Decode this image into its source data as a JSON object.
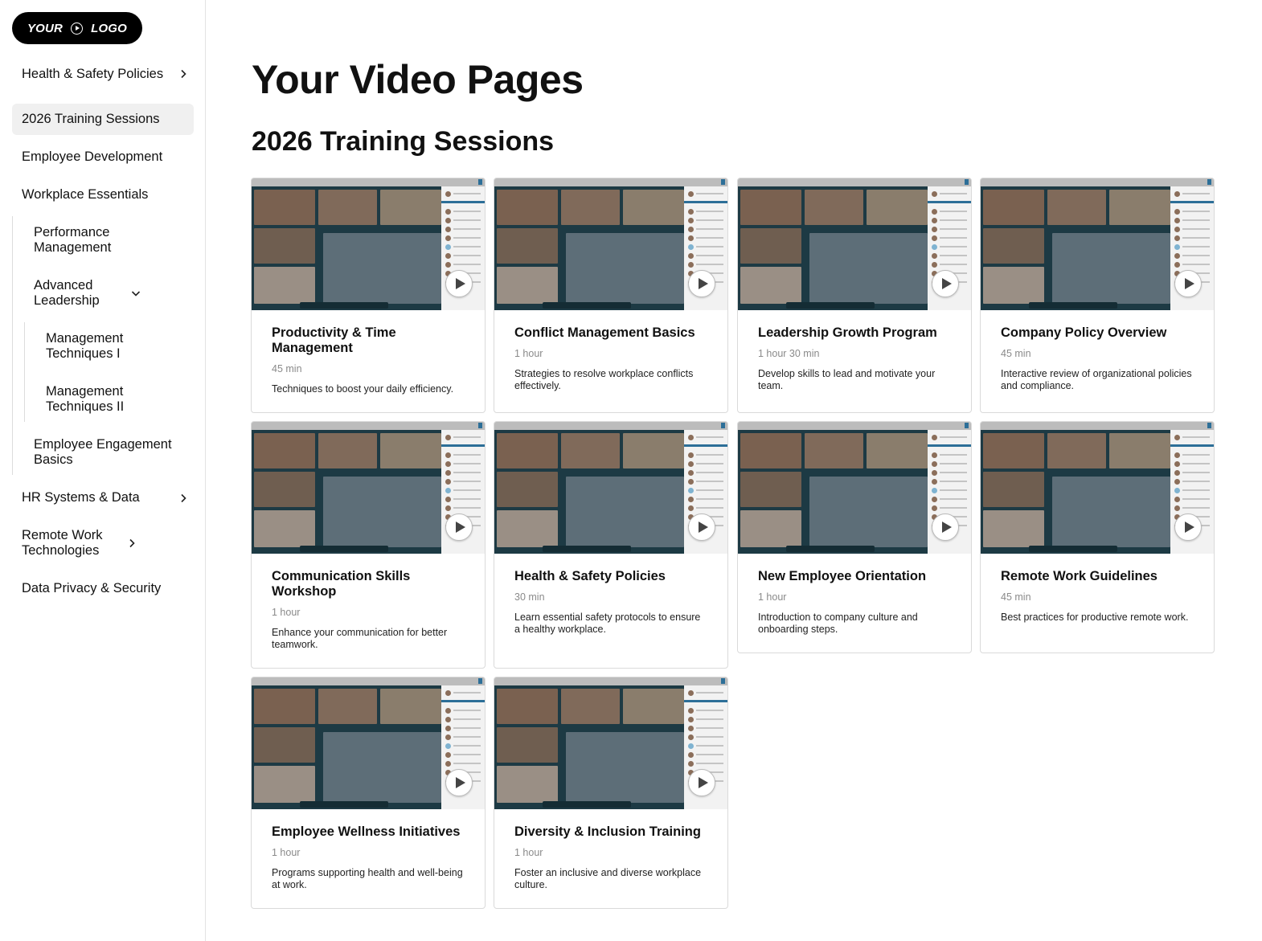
{
  "logo": {
    "left": "YOUR",
    "right": "LOGO"
  },
  "sidebar": {
    "items": [
      {
        "label": "Health & Safety Policies",
        "chevron": "right"
      },
      {
        "label": "2026 Training Sessions",
        "active": true
      },
      {
        "label": "Employee Development"
      },
      {
        "label": "Workplace Essentials"
      },
      {
        "label": "Performance Management"
      },
      {
        "label": "Advanced Leadership",
        "chevron": "down"
      },
      {
        "label": "Management Techniques I"
      },
      {
        "label": "Management Techniques II"
      },
      {
        "label": "Employee Engagement Basics"
      },
      {
        "label": "HR Systems & Data",
        "chevron": "right"
      },
      {
        "label": "Remote Work Technologies",
        "chevron": "right"
      },
      {
        "label": "Data Privacy & Security"
      }
    ]
  },
  "main": {
    "page_title": "Your Video Pages",
    "section_title": "2026 Training Sessions",
    "cards": [
      {
        "title": "Productivity & Time Management",
        "duration": "45 min",
        "description": "Techniques to boost your daily efficiency."
      },
      {
        "title": "Conflict Management Basics",
        "duration": "1 hour",
        "description": "Strategies to resolve workplace conflicts effectively."
      },
      {
        "title": "Leadership Growth Program",
        "duration": "1 hour 30 min",
        "description": "Develop skills to lead and motivate your team."
      },
      {
        "title": "Company Policy Overview",
        "duration": "45 min",
        "description": "Interactive review of organizational policies and compliance."
      },
      {
        "title": "Communication Skills Workshop",
        "duration": "1 hour",
        "description": "Enhance your communication for better teamwork."
      },
      {
        "title": "Health & Safety Policies",
        "duration": "30 min",
        "description": "Learn essential safety protocols to ensure a healthy workplace."
      },
      {
        "title": "New Employee Orientation",
        "duration": "1 hour",
        "description": "Introduction to company culture and onboarding steps."
      },
      {
        "title": "Remote Work Guidelines",
        "duration": "45 min",
        "description": "Best practices for productive remote work."
      },
      {
        "title": "Employee Wellness Initiatives",
        "duration": "1 hour",
        "description": "Programs supporting health and well-being at work."
      },
      {
        "title": "Diversity & Inclusion Training",
        "duration": "1 hour",
        "description": "Foster an inclusive and diverse workplace culture."
      }
    ]
  },
  "colors": {
    "accent": "#2d6f98",
    "active_bg": "#f0f0f0",
    "logo_bg": "#000000"
  }
}
